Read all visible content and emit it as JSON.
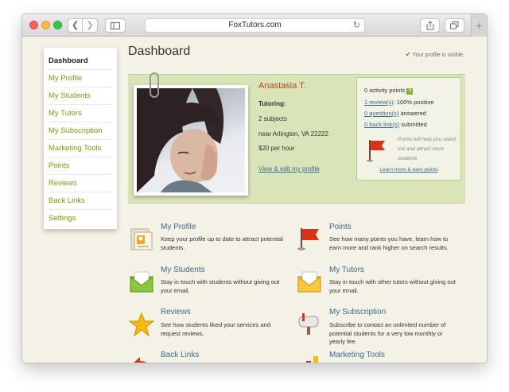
{
  "browser": {
    "url": "FoxTutors.com"
  },
  "sidebar": {
    "items": [
      {
        "label": "Dashboard"
      },
      {
        "label": "My Profile"
      },
      {
        "label": "My Students"
      },
      {
        "label": "My Tutors"
      },
      {
        "label": "My Subscription"
      },
      {
        "label": "Marketing Tools"
      },
      {
        "label": "Points"
      },
      {
        "label": "Reviews"
      },
      {
        "label": "Back Links"
      },
      {
        "label": "Settings"
      }
    ]
  },
  "header": {
    "title": "Dashboard",
    "visibility_note": "Your profile is visible."
  },
  "profile": {
    "name": "Anastasia T.",
    "tutoring_label": "Tutoring:",
    "subjects": "2 subjects",
    "location": "near Arlington, VA 22222",
    "rate": "$20 per hour",
    "edit_link": "View & edit my profile"
  },
  "points_box": {
    "activity_points": "0 activity points",
    "q_badge": "?",
    "reviews_link": "1 review(s)",
    "reviews_suffix": ": 100% positive",
    "questions_link": "0 question(s)",
    "questions_suffix": " answered",
    "backlinks_link": "0 back link(s)",
    "backlinks_suffix": " submitted",
    "note": "Points will help you stand out and attract more students",
    "learn_link": "Learn more & earn points"
  },
  "features": [
    {
      "title": "My Profile",
      "desc": "Keep your profile up to date to attract potential students."
    },
    {
      "title": "Points",
      "desc": "See how many points you have, learn how to earn more and rank higher on search results."
    },
    {
      "title": "My Students",
      "desc": "Stay in touch with students without giving out your email."
    },
    {
      "title": "My Tutors",
      "desc": "Stay in touch with other tutors without giving out your email."
    },
    {
      "title": "Reviews",
      "desc": "See how students liked your services and request reviews."
    },
    {
      "title": "My Subscription",
      "desc": "Subscribe to contact an unlimited number of potential students for a very low monthly or yearly fee."
    },
    {
      "title": "Back Links",
      "desc": ""
    },
    {
      "title": "Marketing Tools",
      "desc": ""
    }
  ],
  "colors": {
    "accent_green": "#6f9d0f",
    "link_blue": "#3a6b8e",
    "name_red": "#b5421a",
    "panel_green": "#d9e5b9"
  }
}
